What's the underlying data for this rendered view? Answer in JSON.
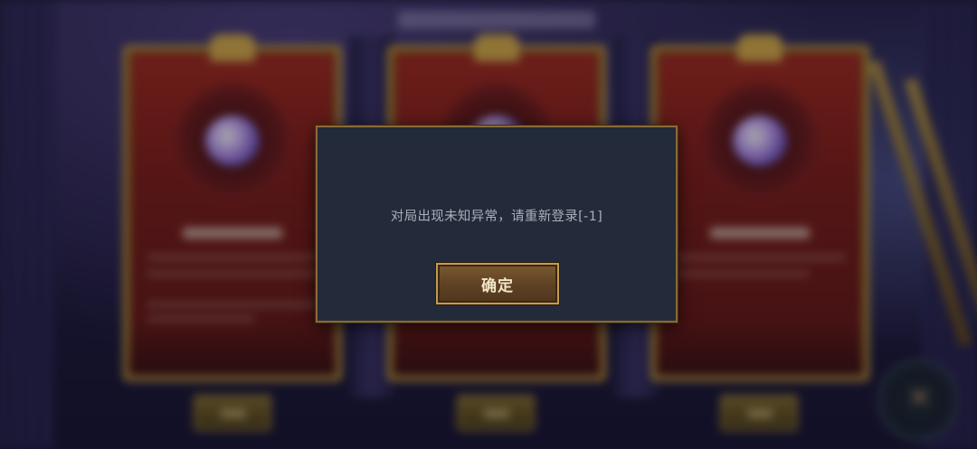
{
  "dialog": {
    "message": "对局出现未知异常，请重新登录[-1]",
    "confirm_label": "确定"
  },
  "colors": {
    "dialog_background": "#232a3a",
    "dialog_border": "#8a6a34",
    "button_fill": "#5e4123",
    "button_border": "#c79a4e",
    "card_red": "#8b2420",
    "card_gold": "#c49a3e"
  },
  "background": {
    "cards": [
      {
        "gem": "crystal-orb-icon"
      },
      {
        "gem": "crystal-orb-icon"
      },
      {
        "gem": "shield-emblem-icon"
      }
    ],
    "choose_buttons": 3
  }
}
